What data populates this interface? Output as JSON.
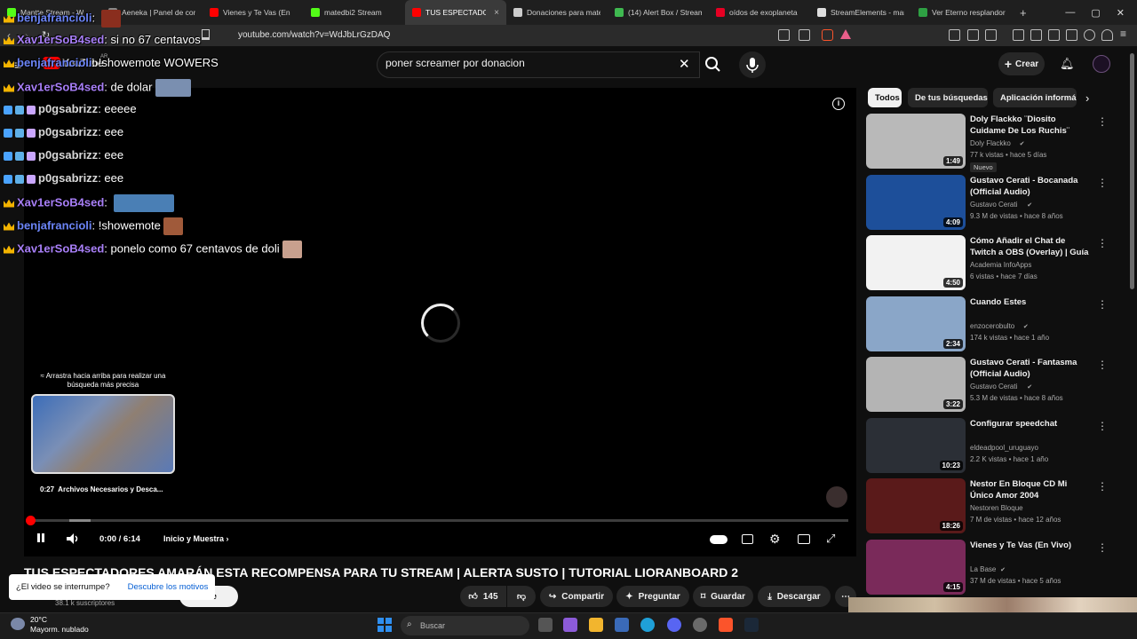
{
  "browser": {
    "tabs": [
      {
        "label": "Mantte Stream - W",
        "color": "#53fc18"
      },
      {
        "label": "Aeneka | Panel de con",
        "color": "#888888"
      },
      {
        "label": "Vienes y Te Vas (En",
        "color": "#ff0000"
      },
      {
        "label": "matedbi2 Stream",
        "color": "#53fc18"
      },
      {
        "label": "TUS ESPECTADOR",
        "color": "#ff0000",
        "active": true
      },
      {
        "label": "Donaciones para mate",
        "color": "#cccccc"
      },
      {
        "label": "(14) Alert Box / Stream",
        "color": "#3fb950"
      },
      {
        "label": "oídos de exoplaneta",
        "color": "#e60023"
      },
      {
        "label": "StreamElements - mar",
        "color": "#dddddd"
      },
      {
        "label": "Ver Eterno resplandor",
        "color": "#2ea043"
      }
    ],
    "tab_close": "×",
    "new_tab": "+",
    "url": "youtube.com/watch?v=WdJbLrGzDAQ",
    "window_controls": [
      "—",
      "▢",
      "✕"
    ]
  },
  "header": {
    "logo": "YouTube",
    "logo_region": "AR",
    "search_value": "poner screamer por donacion",
    "create_label": "Crear"
  },
  "chat": [
    {
      "user": "benjafrancioli",
      "color": "blue",
      "msg": "",
      "badges": [
        "crown"
      ],
      "emote": "#8a2e1e"
    },
    {
      "user": "Xav1erSoB4sed",
      "color": "purple",
      "msg": "si no 67 centavos",
      "badges": [
        "crown"
      ],
      "emote": ""
    },
    {
      "user": "benjafrancioli",
      "color": "blue",
      "msg": "!showemote WOWERS",
      "badges": [
        "crown"
      ],
      "emote": ""
    },
    {
      "user": "Xav1erSoB4sed",
      "color": "purple",
      "msg": "de dolar",
      "badges": [
        "crown"
      ],
      "emote": "#7a8fb0"
    },
    {
      "user": "p0gsabrizz",
      "color": "gray",
      "msg": "eeeee",
      "badges": [
        "sword",
        "bird",
        "bunny"
      ],
      "emote": ""
    },
    {
      "user": "p0gsabrizz",
      "color": "gray",
      "msg": "eee",
      "badges": [
        "sword",
        "bird",
        "bunny"
      ],
      "emote": ""
    },
    {
      "user": "p0gsabrizz",
      "color": "gray",
      "msg": "eee",
      "badges": [
        "sword",
        "bird",
        "bunny"
      ],
      "emote": ""
    },
    {
      "user": "p0gsabrizz",
      "color": "gray",
      "msg": "eee",
      "badges": [
        "sword",
        "bird",
        "bunny"
      ],
      "emote": ""
    },
    {
      "user": "Xav1erSoB4sed",
      "color": "purple",
      "msg": "",
      "badges": [
        "crown"
      ],
      "emote": "#4a7fb5"
    },
    {
      "user": "benjafrancioli",
      "color": "blue",
      "msg": "!showemote",
      "badges": [
        "crown"
      ],
      "emote": "#a05a3a"
    },
    {
      "user": "Xav1erSoB4sed",
      "color": "purple",
      "msg": "ponelo como 67 centavos de doli",
      "badges": [
        "crown"
      ],
      "emote": "#c8a08e"
    }
  ],
  "player": {
    "preview_hint": "≈ Arrastra hacia arriba para realizar una búsqueda más precisa",
    "preview_time": "0:27",
    "preview_chapter": "Archivos Necesarios y Desca...",
    "time": "0:00 / 6:14",
    "chapter": "Inicio y Muestra",
    "progress_fraction": 0.0,
    "buffer_fraction": 0.07
  },
  "video": {
    "title": "TUS ESPECTADORES AMARÁN ESTA RECOMPENSA PARA TU STREAM | ALERTA SUSTO | TUTORIAL LIORANBOARD 2",
    "subscribers": "38.1 k suscriptores",
    "subscribe_partial": "irse",
    "likes": "145",
    "share": "Compartir",
    "ask": "Preguntar",
    "save": "Guardar",
    "download": "Descargar",
    "survey_question": "¿El video se interrumpe?",
    "survey_link": "Descubre los motivos"
  },
  "sidebar": {
    "chips": [
      "Todos",
      "De tus búsquedas",
      "Aplicación informá"
    ],
    "videos": [
      {
        "title": "Doly Flackko ¨Diosito Cuidame De Los Ruchis¨ (Video Oficial) ...",
        "channel": "Doly Flackko",
        "verified": true,
        "meta": "77 k vistas • hace 5 días",
        "badge": "Nuevo",
        "duration": "1:49",
        "thumb": "#b9b9b9"
      },
      {
        "title": "Gustavo Cerati - Bocanada (Official Audio)",
        "channel": "Gustavo Cerati",
        "verified": true,
        "meta": "9.3 M de vistas • hace 8 años",
        "badge": "",
        "duration": "4:09",
        "thumb": "#1d4f9a"
      },
      {
        "title": "Cómo Añadir el Chat de Twitch a OBS (Overlay) | Guía Completa",
        "channel": "Academia InfoApps",
        "verified": false,
        "meta": "6 vistas • hace 7 días",
        "badge": "",
        "duration": "4:50",
        "thumb": "#f2f2f2"
      },
      {
        "title": "Cuando Estes",
        "channel": "enzocerobulto",
        "verified": true,
        "meta": "174 k vistas • hace 1 año",
        "badge": "",
        "duration": "2:34",
        "thumb": "#8aa6c8"
      },
      {
        "title": "Gustavo Cerati - Fantasma (Official Audio)",
        "channel": "Gustavo Cerati",
        "verified": true,
        "meta": "5.3 M de vistas • hace 8 años",
        "badge": "",
        "duration": "3:22",
        "thumb": "#b4b4b4"
      },
      {
        "title": "Configurar speedchat",
        "channel": "eldeadpool_uruguayo",
        "verified": false,
        "meta": "2.2 K vistas • hace 1 año",
        "badge": "",
        "duration": "10:23",
        "thumb": "#2b2f36"
      },
      {
        "title": "Nestor En Bloque CD Mi Único Amor 2004",
        "channel": "Nestoren Bloque",
        "verified": false,
        "meta": "7 M de vistas • hace 12 años",
        "badge": "",
        "duration": "18:26",
        "thumb": "#5a1a1a"
      },
      {
        "title": "Vienes y Te Vas (En Vivo)",
        "channel": "La Base",
        "verified": true,
        "meta": "37 M de vistas • hace 5 años",
        "badge": "",
        "duration": "4:15",
        "thumb": "#7a2a5a"
      }
    ]
  },
  "taskbar": {
    "temp": "20°C",
    "weather": "Mayorm. nublado",
    "search": "Buscar"
  },
  "colors": {
    "accent": "#ff0000",
    "link": "#065fd4"
  }
}
